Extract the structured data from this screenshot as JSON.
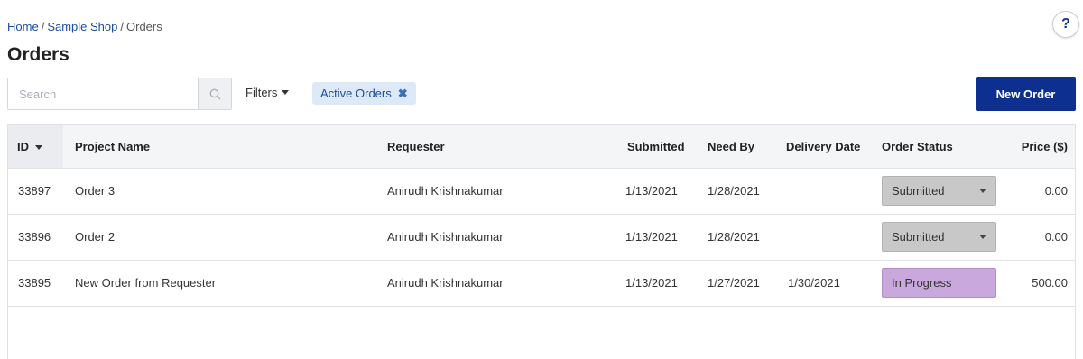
{
  "breadcrumb": {
    "home": "Home",
    "shop": "Sample Shop",
    "current": "Orders",
    "separator": "/"
  },
  "help": {
    "label": "?"
  },
  "page_title": "Orders",
  "search": {
    "placeholder": "Search",
    "value": ""
  },
  "filters": {
    "label": "Filters"
  },
  "active_chip": {
    "label": "Active Orders",
    "remove": "✖"
  },
  "new_order": {
    "label": "New Order"
  },
  "table": {
    "columns": {
      "id": "ID",
      "project": "Project Name",
      "requester": "Requester",
      "submitted": "Submitted",
      "need_by": "Need By",
      "delivery": "Delivery Date",
      "status": "Order Status",
      "price": "Price ($)"
    },
    "rows": [
      {
        "id": "33897",
        "project": "Order 3",
        "requester": "Anirudh Krishnakumar",
        "submitted": "1/13/2021",
        "need_by": "1/28/2021",
        "delivery": "",
        "status": "Submitted",
        "price": "0.00"
      },
      {
        "id": "33896",
        "project": "Order 2",
        "requester": "Anirudh Krishnakumar",
        "submitted": "1/13/2021",
        "need_by": "1/28/2021",
        "delivery": "",
        "status": "Submitted",
        "price": "0.00"
      },
      {
        "id": "33895",
        "project": "New Order from Requester",
        "requester": "Anirudh Krishnakumar",
        "submitted": "1/13/2021",
        "need_by": "1/27/2021",
        "delivery": "1/30/2021",
        "status": "In Progress",
        "price": "500.00"
      }
    ]
  },
  "colors": {
    "primary": "#0d2f8f",
    "link": "#1a4d9e",
    "chip_bg": "#dde9f6",
    "status_submitted": "#c8c8c8",
    "status_in_progress": "#c9a8dd"
  }
}
